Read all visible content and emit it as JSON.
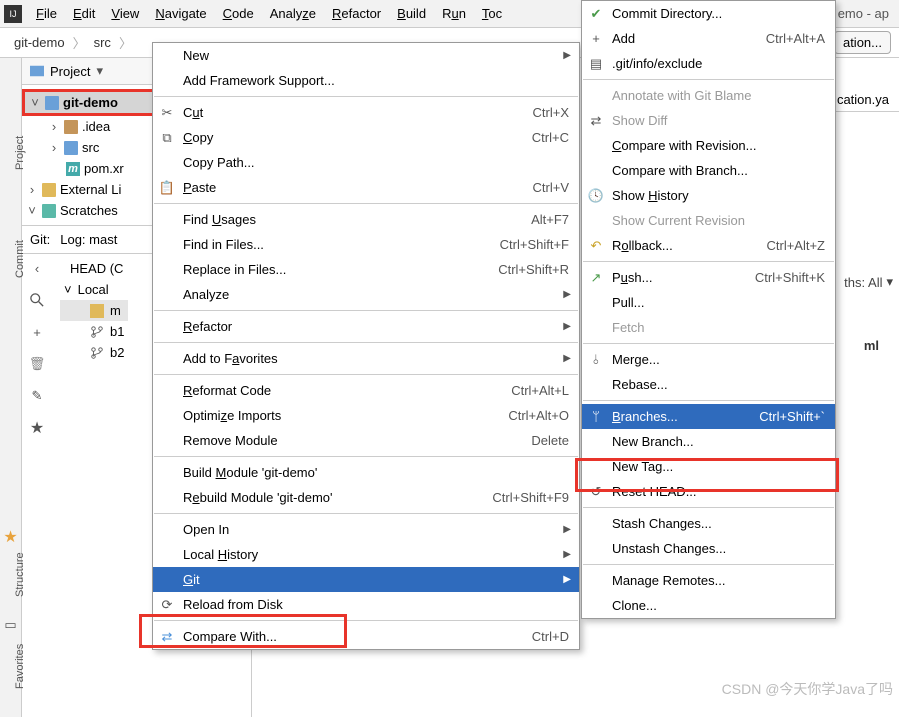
{
  "menubar": {
    "items": [
      "File",
      "Edit",
      "View",
      "Navigate",
      "Code",
      "Analyze",
      "Refactor",
      "Build",
      "Run",
      "Toc"
    ],
    "title_right": "emo - ap"
  },
  "breadcrumb": {
    "crumb1": "git-demo",
    "crumb2": "src",
    "right_btn": "ation..."
  },
  "editor_tab_right": "cation.ya",
  "sidebar": {
    "header": "Project",
    "items": [
      {
        "label": "git-demo",
        "bold": true
      },
      {
        "label": ".idea"
      },
      {
        "label": "src"
      },
      {
        "label": "pom.xr"
      },
      {
        "label": "External Li"
      },
      {
        "label": "Scratches"
      }
    ]
  },
  "git": {
    "line": "Git:",
    "log": "Log: mast",
    "head": "HEAD (C",
    "local": "Local",
    "branches": [
      "m",
      "b1",
      "b2"
    ]
  },
  "paths_label": "ths: All",
  "ml_file": "ml",
  "menu1": {
    "new": "New",
    "framework": "Add Framework Support...",
    "cut": "Cut",
    "cut_sc": "Ctrl+X",
    "copy": "Copy",
    "copy_sc": "Ctrl+C",
    "copypath": "Copy Path...",
    "paste": "Paste",
    "paste_sc": "Ctrl+V",
    "findusages": "Find Usages",
    "findusages_sc": "Alt+F7",
    "findfiles": "Find in Files...",
    "findfiles_sc": "Ctrl+Shift+F",
    "replace": "Replace in Files...",
    "replace_sc": "Ctrl+Shift+R",
    "analyze": "Analyze",
    "refactor": "Refactor",
    "favorites": "Add to Favorites",
    "reformat": "Reformat Code",
    "reformat_sc": "Ctrl+Alt+L",
    "optimize": "Optimize Imports",
    "optimize_sc": "Ctrl+Alt+O",
    "remove": "Remove Module",
    "remove_sc": "Delete",
    "buildm": "Build Module 'git-demo'",
    "rebuildm": "Rebuild Module 'git-demo'",
    "rebuildm_sc": "Ctrl+Shift+F9",
    "openin": "Open In",
    "history": "Local History",
    "git": "Git",
    "reload": "Reload from Disk",
    "compare": "Compare With...",
    "compare_sc": "Ctrl+D"
  },
  "menu2": {
    "commitdir": "Commit Directory...",
    "add": "Add",
    "add_sc": "Ctrl+Alt+A",
    "exclude": ".git/info/exclude",
    "annotate": "Annotate with Git Blame",
    "showdiff": "Show Diff",
    "comparerev": "Compare with Revision...",
    "comparebr": "Compare with Branch...",
    "showhist": "Show History",
    "showcur": "Show Current Revision",
    "rollback": "Rollback...",
    "rollback_sc": "Ctrl+Alt+Z",
    "push": "Push...",
    "push_sc": "Ctrl+Shift+K",
    "pull": "Pull...",
    "fetch": "Fetch",
    "merge": "Merge...",
    "rebase": "Rebase...",
    "branches": "Branches...",
    "branches_sc": "Ctrl+Shift+`",
    "newbranch": "New Branch...",
    "newtag": "New Tag...",
    "resethead": "Reset HEAD...",
    "stash": "Stash Changes...",
    "unstash": "Unstash Changes...",
    "remotes": "Manage Remotes...",
    "clone": "Clone..."
  },
  "watermark": "CSDN @今天你学Java了吗"
}
